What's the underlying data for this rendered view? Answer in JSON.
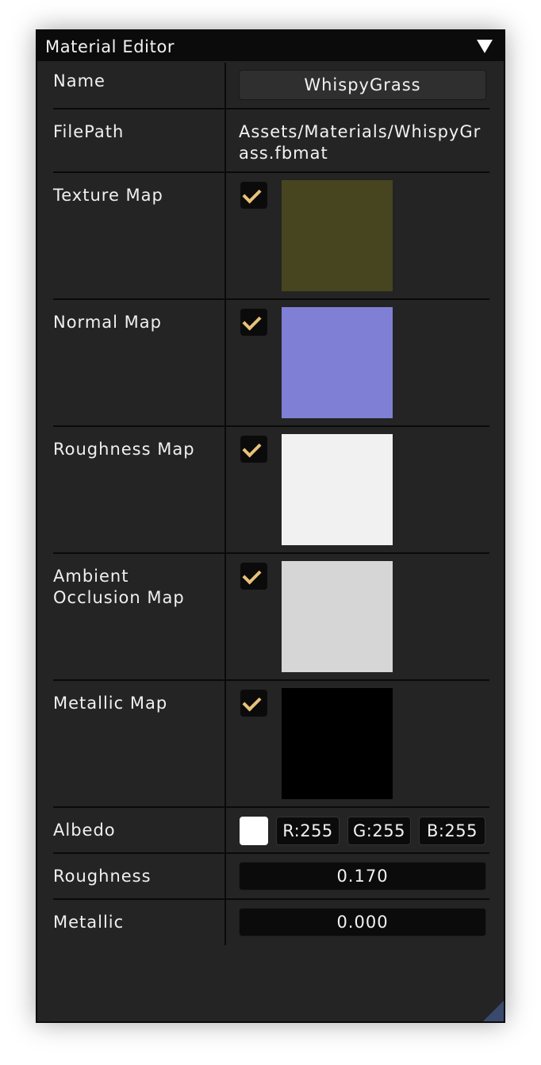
{
  "window": {
    "title": "Material Editor"
  },
  "fields": {
    "name_label": "Name",
    "name_value": "WhispyGrass",
    "filepath_label": "FilePath",
    "filepath_value": "Assets/Materials/WhispyGrass.fbmat",
    "albedo_label": "Albedo",
    "roughness_label": "Roughness",
    "metallic_label": "Metallic"
  },
  "maps": [
    {
      "label": "Texture Map",
      "enabled": true,
      "color": "#46451f"
    },
    {
      "label": "Normal Map",
      "enabled": true,
      "color": "#7f7fd6"
    },
    {
      "label": "Roughness Map",
      "enabled": true,
      "color": "#f1f1f1"
    },
    {
      "label": "Ambient Occlusion Map",
      "enabled": true,
      "color": "#d6d6d6"
    },
    {
      "label": "Metallic Map",
      "enabled": true,
      "color": "#000000"
    }
  ],
  "albedo": {
    "r": "R:255",
    "g": "G:255",
    "b": "B:255",
    "color": "#ffffff"
  },
  "roughness_value": "0.170",
  "metallic_value": "0.000",
  "colors": {
    "checkmark": "#e8c27a",
    "panel_bg": "#242424",
    "titlebar_bg": "#0b0b0b"
  }
}
